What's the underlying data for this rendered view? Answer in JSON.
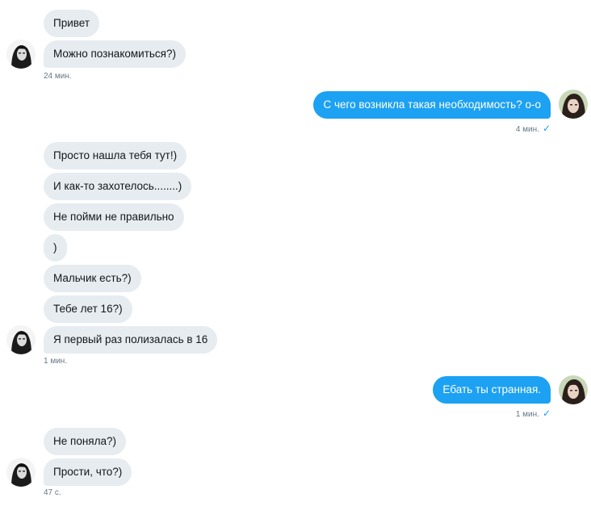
{
  "conversation": {
    "groups": [
      {
        "side": "in",
        "messages": [
          "Привет",
          "Можно познакомиться?)"
        ],
        "time": "24 мин."
      },
      {
        "side": "out",
        "messages": [
          "С чего возникла такая необходимость? о-о"
        ],
        "time": "4 мин.",
        "read_icon": "checkmark-icon"
      },
      {
        "side": "in",
        "messages": [
          "Просто нашла тебя тут!)",
          "И как-то захотелось........)",
          "Не пойми не правильно",
          ")",
          "Мальчик есть?)",
          "Тебе лет 16?)",
          "Я первый раз полизалась в 16"
        ],
        "time": "1 мин."
      },
      {
        "side": "out",
        "messages": [
          "Ебать ты странная."
        ],
        "time": "1 мин.",
        "read_icon": "checkmark-icon"
      },
      {
        "side": "in",
        "messages": [
          "Не поняла?)",
          "Прости, что?)"
        ],
        "time": "47 с."
      }
    ]
  },
  "colors": {
    "incoming_bubble": "#e6ecf0",
    "outgoing_bubble": "#1da1f2",
    "meta_text": "#657786"
  }
}
